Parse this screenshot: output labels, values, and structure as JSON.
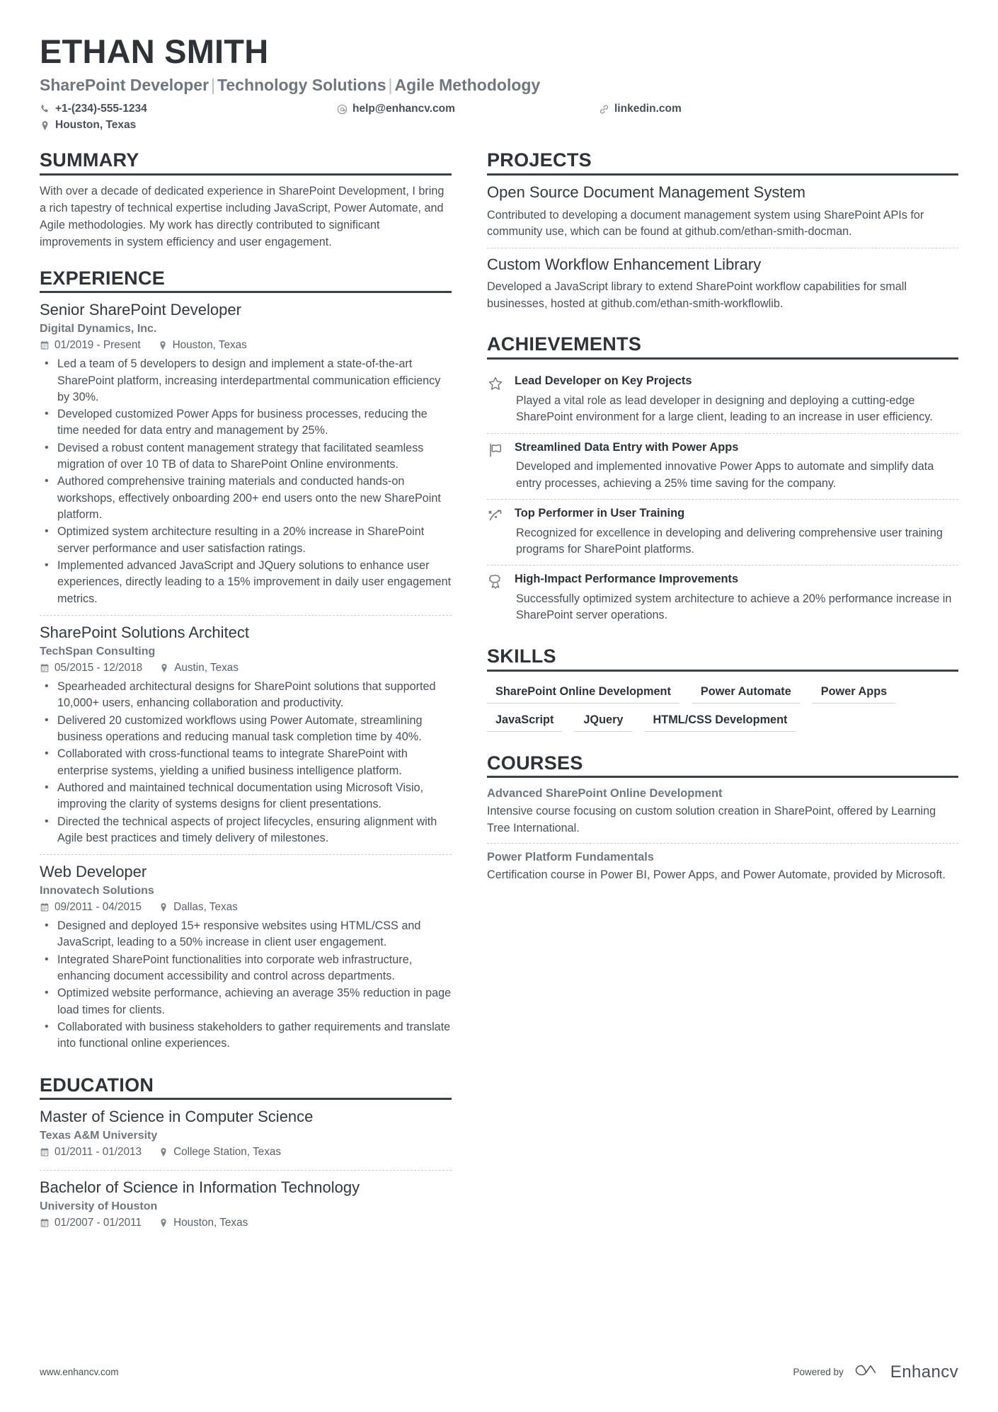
{
  "header": {
    "name": "ETHAN SMITH",
    "title_parts": [
      "SharePoint Developer",
      "Technology Solutions",
      "Agile Methodology"
    ],
    "title_separator": "|",
    "contacts": [
      {
        "icon": "phone-icon",
        "value": "+1-(234)-555-1234"
      },
      {
        "icon": "email-icon",
        "value": "help@enhancv.com"
      },
      {
        "icon": "link-icon",
        "value": "linkedin.com"
      },
      {
        "icon": "location-icon",
        "value": "Houston, Texas"
      }
    ]
  },
  "summary": {
    "heading": "SUMMARY",
    "text": "With over a decade of dedicated experience in SharePoint Development, I bring a rich tapestry of technical expertise including JavaScript, Power Automate, and Agile methodologies. My work has directly contributed to significant improvements in system efficiency and user engagement."
  },
  "experience": {
    "heading": "EXPERIENCE",
    "entries": [
      {
        "title": "Senior SharePoint Developer",
        "org": "Digital Dynamics, Inc.",
        "dates": "01/2019 - Present",
        "location": "Houston, Texas",
        "bullets": [
          "Led a team of 5 developers to design and implement a state-of-the-art SharePoint platform, increasing interdepartmental communication efficiency by 30%.",
          "Developed customized Power Apps for business processes, reducing the time needed for data entry and management by 25%.",
          "Devised a robust content management strategy that facilitated seamless migration of over 10 TB of data to SharePoint Online environments.",
          "Authored comprehensive training materials and conducted hands-on workshops, effectively onboarding 200+ end users onto the new SharePoint platform.",
          "Optimized system architecture resulting in a 20% increase in SharePoint server performance and user satisfaction ratings.",
          "Implemented advanced JavaScript and JQuery solutions to enhance user experiences, directly leading to a 15% improvement in daily user engagement metrics."
        ]
      },
      {
        "title": "SharePoint Solutions Architect",
        "org": "TechSpan Consulting",
        "dates": "05/2015 - 12/2018",
        "location": "Austin, Texas",
        "bullets": [
          "Spearheaded architectural designs for SharePoint solutions that supported 10,000+ users, enhancing collaboration and productivity.",
          "Delivered 20 customized workflows using Power Automate, streamlining business operations and reducing manual task completion time by 40%.",
          "Collaborated with cross-functional teams to integrate SharePoint with enterprise systems, yielding a unified business intelligence platform.",
          "Authored and maintained technical documentation using Microsoft Visio, improving the clarity of systems designs for client presentations.",
          "Directed the technical aspects of project lifecycles, ensuring alignment with Agile best practices and timely delivery of milestones."
        ]
      },
      {
        "title": "Web Developer",
        "org": "Innovatech Solutions",
        "dates": "09/2011 - 04/2015",
        "location": "Dallas, Texas",
        "bullets": [
          "Designed and deployed 15+ responsive websites using HTML/CSS and JavaScript, leading to a 50% increase in client user engagement.",
          "Integrated SharePoint functionalities into corporate web infrastructure, enhancing document accessibility and control across departments.",
          "Optimized website performance, achieving an average 35% reduction in page load times for clients.",
          "Collaborated with business stakeholders to gather requirements and translate into functional online experiences."
        ]
      }
    ]
  },
  "education": {
    "heading": "EDUCATION",
    "entries": [
      {
        "title": "Master of Science in Computer Science",
        "org": "Texas A&M University",
        "dates": "01/2011 - 01/2013",
        "location": "College Station, Texas"
      },
      {
        "title": "Bachelor of Science in Information Technology",
        "org": "University of Houston",
        "dates": "01/2007 - 01/2011",
        "location": "Houston, Texas"
      }
    ]
  },
  "projects": {
    "heading": "PROJECTS",
    "entries": [
      {
        "title": "Open Source Document Management System",
        "desc": "Contributed to developing a document management system using SharePoint APIs for community use, which can be found at github.com/ethan-smith-docman."
      },
      {
        "title": "Custom Workflow Enhancement Library",
        "desc": "Developed a JavaScript library to extend SharePoint workflow capabilities for small businesses, hosted at github.com/ethan-smith-workflowlib."
      }
    ]
  },
  "achievements": {
    "heading": "ACHIEVEMENTS",
    "entries": [
      {
        "icon": "star-icon",
        "title": "Lead Developer on Key Projects",
        "desc": "Played a vital role as lead developer in designing and deploying a cutting-edge SharePoint environment for a large client, leading to an increase in user efficiency."
      },
      {
        "icon": "flag-icon",
        "title": "Streamlined Data Entry with Power Apps",
        "desc": "Developed and implemented innovative Power Apps to automate and simplify data entry processes, achieving a 25% time saving for the company."
      },
      {
        "icon": "rocket-icon",
        "title": "Top Performer in User Training",
        "desc": "Recognized for excellence in developing and delivering comprehensive user training programs for SharePoint platforms."
      },
      {
        "icon": "award-medal-icon",
        "title": "High-Impact Performance Improvements",
        "desc": "Successfully optimized system architecture to achieve a 20% performance increase in SharePoint server operations."
      }
    ]
  },
  "skills": {
    "heading": "SKILLS",
    "items": [
      "SharePoint Online Development",
      "Power Automate",
      "Power Apps",
      "JavaScript",
      "JQuery",
      "HTML/CSS Development"
    ]
  },
  "courses": {
    "heading": "COURSES",
    "entries": [
      {
        "title": "Advanced SharePoint Online Development",
        "desc": "Intensive course focusing on custom solution creation in SharePoint, offered by Learning Tree International."
      },
      {
        "title": "Power Platform Fundamentals",
        "desc": "Certification course in Power BI, Power Apps, and Power Automate, provided by Microsoft."
      }
    ]
  },
  "footer": {
    "url": "www.enhancv.com",
    "powered_by": "Powered by",
    "brand": "Enhancv"
  },
  "colors": {
    "text_dark": "#2f3337",
    "text_body": "#4a5056",
    "text_muted": "#6f767d",
    "rule": "#3c4146",
    "dashed": "#c9ced3"
  }
}
